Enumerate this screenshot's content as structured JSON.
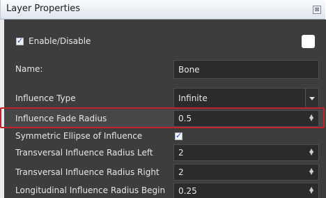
{
  "window": {
    "title": "Layer Properties",
    "close_glyph": "⊠"
  },
  "enable": {
    "label": "Enable/Disable",
    "checked": true
  },
  "fields": {
    "name_label": "Name:",
    "name_value": "Bone",
    "influence_type_label": "Influence Type",
    "influence_type_value": "Infinite",
    "influence_fade_radius_label": "Influence Fade Radius",
    "influence_fade_radius_value": "0.5",
    "symmetric_ellipse_label": "Symmetric Ellipse of Influence",
    "symmetric_ellipse_checked": true,
    "transversal_left_label": "Transversal Influence Radius Left",
    "transversal_left_value": "2",
    "transversal_right_label": "Transversal Influence Radius Right",
    "transversal_right_value": "2",
    "longitudinal_begin_label": "Longitudinal Influence Radius Begin",
    "longitudinal_begin_value": "0.25"
  },
  "colors": {
    "panel_bg": "#3d3d3d",
    "field_bg": "#2b2b2b",
    "highlight_border": "#c0232b",
    "check_color": "#2745b8"
  },
  "icons": {
    "close": "close-icon",
    "checkmark": "checkmark-icon",
    "spinner": "spinner-arrows-icon",
    "dropdown": "chevron-down-icon"
  }
}
